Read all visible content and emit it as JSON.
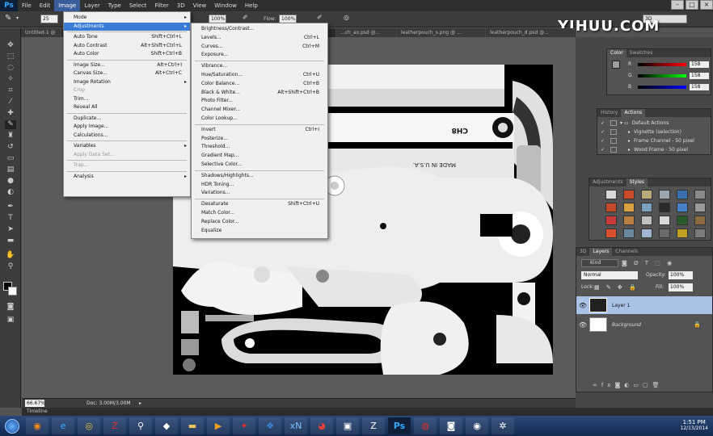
{
  "menubar": {
    "logo": "Ps",
    "items": [
      "File",
      "Edit",
      "Image",
      "Layer",
      "Type",
      "Select",
      "Filter",
      "3D",
      "View",
      "Window",
      "Help"
    ]
  },
  "window_controls": [
    "–",
    "□",
    "×"
  ],
  "watermark": "YIHUU.COM",
  "options_bar": {
    "brush_size": "25",
    "flow_label": "Flow:",
    "flow_value": "100%",
    "opacity_value": "100%",
    "workspace": "3D"
  },
  "tabs": [
    {
      "label": "Untitled-1 @ 6..."
    },
    {
      "label": "...ch_ao.psd @..."
    },
    {
      "label": "leatherpouch_s.png @ ..."
    },
    {
      "label": "leatherpouch_d.psd @..."
    }
  ],
  "image_menu": {
    "items": [
      {
        "label": "Mode",
        "shortcut": "",
        "submenu": true
      },
      {
        "label": "Adjustments",
        "shortcut": "",
        "submenu": true,
        "highlighted": true
      },
      {
        "label": "Auto Tone",
        "shortcut": "Shift+Ctrl+L"
      },
      {
        "label": "Auto Contrast",
        "shortcut": "Alt+Shift+Ctrl+L"
      },
      {
        "label": "Auto Color",
        "shortcut": "Shift+Ctrl+B"
      },
      {
        "label": "Image Size...",
        "shortcut": "Alt+Ctrl+I"
      },
      {
        "label": "Canvas Size...",
        "shortcut": "Alt+Ctrl+C"
      },
      {
        "label": "Image Rotation",
        "shortcut": "",
        "submenu": true
      },
      {
        "label": "Crop",
        "shortcut": "",
        "disabled": true
      },
      {
        "label": "Trim...",
        "shortcut": ""
      },
      {
        "label": "Reveal All",
        "shortcut": ""
      },
      {
        "label": "Duplicate...",
        "shortcut": ""
      },
      {
        "label": "Apply Image...",
        "shortcut": ""
      },
      {
        "label": "Calculations...",
        "shortcut": ""
      },
      {
        "label": "Variables",
        "shortcut": "",
        "submenu": true
      },
      {
        "label": "Apply Data Set...",
        "shortcut": "",
        "disabled": true
      },
      {
        "label": "Trap...",
        "shortcut": "",
        "disabled": true
      },
      {
        "label": "Analysis",
        "shortcut": "",
        "submenu": true
      }
    ]
  },
  "adjustments_menu": {
    "items": [
      {
        "label": "Brightness/Contrast...",
        "shortcut": ""
      },
      {
        "label": "Levels...",
        "shortcut": "Ctrl+L"
      },
      {
        "label": "Curves...",
        "shortcut": "Ctrl+M"
      },
      {
        "label": "Exposure...",
        "shortcut": ""
      },
      {
        "label": "Vibrance...",
        "shortcut": ""
      },
      {
        "label": "Hue/Saturation...",
        "shortcut": "Ctrl+U"
      },
      {
        "label": "Color Balance...",
        "shortcut": "Ctrl+B"
      },
      {
        "label": "Black & White...",
        "shortcut": "Alt+Shift+Ctrl+B"
      },
      {
        "label": "Photo Filter...",
        "shortcut": ""
      },
      {
        "label": "Channel Mixer...",
        "shortcut": ""
      },
      {
        "label": "Color Lookup...",
        "shortcut": ""
      },
      {
        "label": "Invert",
        "shortcut": "Ctrl+I"
      },
      {
        "label": "Posterize...",
        "shortcut": ""
      },
      {
        "label": "Threshold...",
        "shortcut": ""
      },
      {
        "label": "Gradient Map...",
        "shortcut": ""
      },
      {
        "label": "Selective Color...",
        "shortcut": ""
      },
      {
        "label": "Shadows/Highlights...",
        "shortcut": ""
      },
      {
        "label": "HDR Toning...",
        "shortcut": ""
      },
      {
        "label": "Variations...",
        "shortcut": ""
      },
      {
        "label": "Desaturate",
        "shortcut": "Shift+Ctrl+U"
      },
      {
        "label": "Match Color...",
        "shortcut": ""
      },
      {
        "label": "Replace Color...",
        "shortcut": ""
      },
      {
        "label": "Equalize",
        "shortcut": ""
      }
    ]
  },
  "canvas_text": {
    "label_a": "CH8",
    "label_b": "MADE IN U.S.A."
  },
  "status_bar": {
    "zoom": "66.67%",
    "doc": "Doc: 3.00M/3.00M"
  },
  "timeline_label": "Timeline",
  "color_panel": {
    "tabs": [
      "Color",
      "Swatches"
    ],
    "rows": [
      {
        "label": "R",
        "value": "158"
      },
      {
        "label": "G",
        "value": "158"
      },
      {
        "label": "B",
        "value": "158"
      }
    ]
  },
  "history_panel": {
    "tabs": [
      "History",
      "Actions"
    ],
    "rows": [
      {
        "label": "Default Actions"
      },
      {
        "label": "Vignette (selection)"
      },
      {
        "label": "Frame Channel - 50 pixel"
      },
      {
        "label": "Wood Frame - 50 pixel"
      }
    ]
  },
  "adjustments_panel": {
    "tabs": [
      "Adjustments",
      "Styles"
    ],
    "swatch_colors": [
      "#d8d8d8",
      "#c84a2a",
      "#b9a97a",
      "#9aa6b0",
      "#3a6fb0",
      "#8a8a8a",
      "#c24a2a",
      "#d8a040",
      "#7aa0c0",
      "#2a2a2a",
      "#4a80c8",
      "#9a9a9a",
      "#c83a3a",
      "#b88040",
      "#c0c0c0",
      "#d8d8d8",
      "#2a5a2a",
      "#8a6a40",
      "#d85030",
      "#6a8aa0",
      "#a0b8d0",
      "#6a6a6a",
      "#c0a020",
      "#7a7a7a"
    ]
  },
  "layers_panel": {
    "tabs": [
      "3D",
      "Layers",
      "Channels"
    ],
    "kind": "Kind",
    "blend_mode": "Normal",
    "opacity_label": "Opacity:",
    "opacity_value": "100%",
    "lock_label": "Lock:",
    "fill_label": "Fill:",
    "fill_value": "100%",
    "layers": [
      {
        "name": "Layer 1"
      },
      {
        "name": "Background"
      }
    ]
  },
  "taskbar": {
    "time": "1:51 PM",
    "date": "12/13/2014"
  }
}
